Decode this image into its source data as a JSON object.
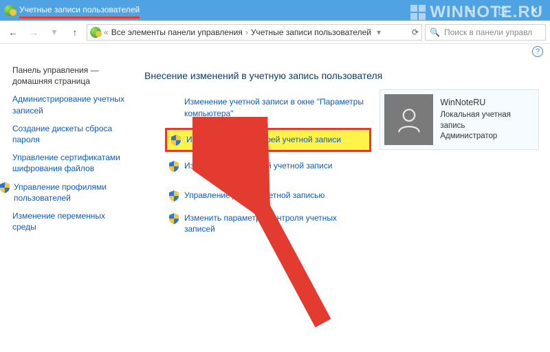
{
  "window": {
    "title": "Учетные записи пользователей"
  },
  "watermark": "WINNOTE.RU",
  "breadcrumb": {
    "root_glyph": "«",
    "item1": "Все элементы панели управления",
    "item2": "Учетные записи пользователей"
  },
  "search": {
    "placeholder": "Поиск в панели управл"
  },
  "sidebar": {
    "heading": "Панель управления — домашняя страница",
    "items": [
      "Администрирование учетных записей",
      "Создание дискеты сброса пароля",
      "Управление сертификатами шифрования файлов",
      "Управление профилями пользователей",
      "Изменение переменных среды"
    ]
  },
  "main": {
    "heading": "Внесение изменений в учетную запись пользователя"
  },
  "tasks": {
    "t0": "Изменение учетной записи в окне \"Параметры компьютера\"",
    "t1": "Изменение имени своей учетной записи",
    "t2": "Изменение типа своей учетной записи",
    "t3": "Управление другой учетной записью",
    "t4": "Изменить параметры контроля учетных записей"
  },
  "account": {
    "name": "WinNoteRU",
    "type": "Локальная учетная запись",
    "role": "Администратор"
  }
}
